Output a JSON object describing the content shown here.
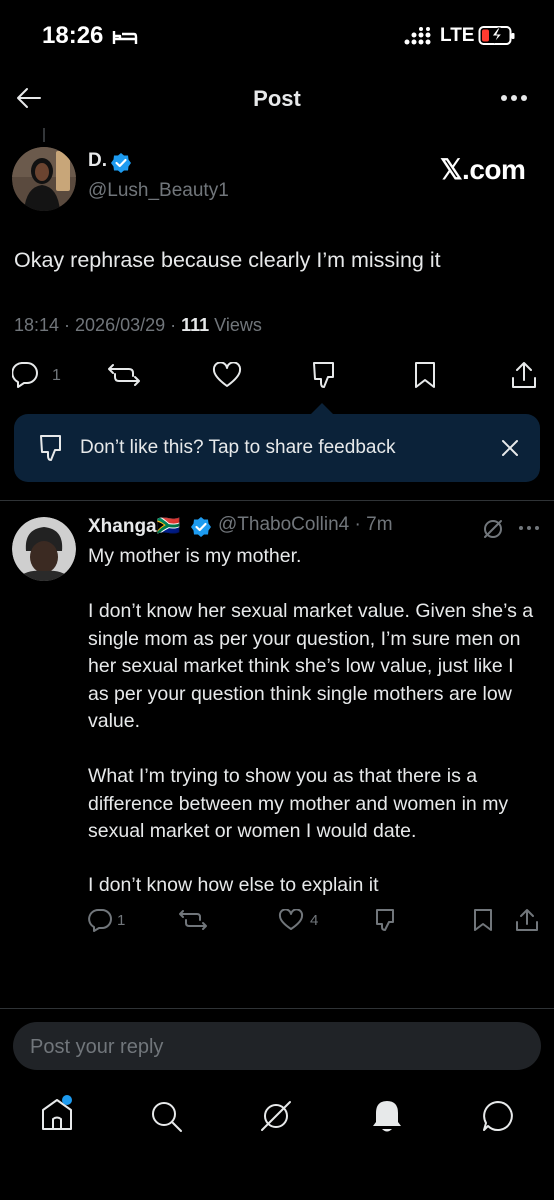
{
  "status_bar": {
    "time": "18:26",
    "network": "LTE"
  },
  "header": {
    "title": "Post"
  },
  "post": {
    "author_name": "D.",
    "author_handle": "@Lush_Beauty1",
    "watermark": "𝕏.com",
    "text": "Okay rephrase because clearly I’m missing it",
    "meta_prefix": "18:14 · 2026/03/29 · ",
    "views_count": "111",
    "views_label": " Views",
    "reply_count": "1"
  },
  "feedback": {
    "text": "Don’t like this? Tap to share feedback"
  },
  "reply": {
    "author_name": "Xhanga🇿🇦",
    "author_handle": "@ThaboCollin4",
    "time": "7m",
    "paragraphs": [
      "My mother is my mother.",
      "I don’t know her sexual market value. Given she’s a single mom as per your question, I’m sure men on her sexual market think she’s low value, just like I as per your question think single mothers are low value.",
      "What I’m trying to show you as that there is a difference between my mother and women in my sexual market or women I would date.",
      "I don’t know how else to explain it"
    ],
    "reply_count": "1",
    "like_count": "4"
  },
  "composer": {
    "placeholder": "Post your reply"
  },
  "colors": {
    "background": "#000000",
    "text": "#e7e9ea",
    "muted": "#71767b",
    "accent": "#1d9bf0",
    "feedback_bg": "#0b2239"
  },
  "icons": [
    "back-arrow-icon",
    "more-icon",
    "verified-icon",
    "reply-icon",
    "repost-icon",
    "like-icon",
    "dislike-icon",
    "bookmark-icon",
    "share-icon",
    "grok-icon",
    "close-icon",
    "home-icon",
    "search-icon",
    "notifications-icon",
    "messages-icon"
  ]
}
